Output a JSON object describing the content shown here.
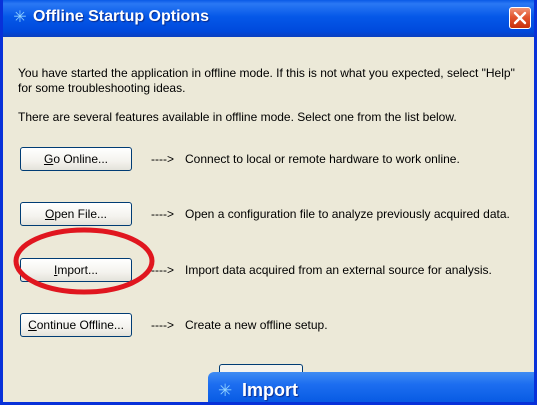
{
  "window": {
    "title": "Offline Startup Options",
    "title_icon": "asterisk-logo-icon",
    "close_icon": "close-icon"
  },
  "intro": {
    "line1": "You have started the application in offline mode. If this is not what you expected, select \"Help\" for some troubleshooting ideas.",
    "line2": "There are several features available in offline mode. Select one from the list below."
  },
  "options": [
    {
      "mnemonic": "G",
      "label_rest": "o Online...",
      "arrow": "---->",
      "description": "Connect to local or remote hardware to work online."
    },
    {
      "mnemonic": "O",
      "label_rest": "pen File...",
      "arrow": "---->",
      "description": "Open a configuration file to analyze previously acquired data."
    },
    {
      "mnemonic": "I",
      "label_rest": "mport...",
      "arrow": "---->",
      "description": "Import data acquired from an external source for analysis."
    },
    {
      "mnemonic": "C",
      "label_rest": "ontinue Offline...",
      "arrow": "---->",
      "description": "Create a new offline setup."
    }
  ],
  "highlight": {
    "color": "#e0161f",
    "target": "Import..."
  },
  "import_dialog": {
    "title": "Import",
    "title_icon": "asterisk-logo-icon"
  },
  "colors": {
    "titlebar": "#0558e8",
    "window_bg": "#ece9d8",
    "close_button": "#e2552f",
    "button_border": "#003c74"
  }
}
